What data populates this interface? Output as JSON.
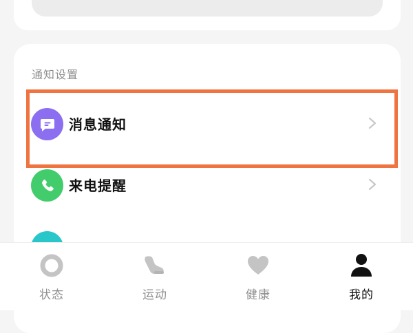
{
  "section": {
    "title": "通知设置"
  },
  "rows": [
    {
      "label": "消息通知",
      "icon": "message-icon",
      "color": "#8b6ff0"
    },
    {
      "label": "来电提醒",
      "icon": "phone-icon",
      "color": "#43cc6c"
    },
    {
      "label": "",
      "icon": "app-icon",
      "color": "#29c7c9"
    }
  ],
  "highlight_color": "#f07442",
  "tabbar": {
    "tabs": [
      {
        "label": "状态",
        "icon": "status-ring-icon",
        "active": false
      },
      {
        "label": "运动",
        "icon": "shoe-icon",
        "active": false
      },
      {
        "label": "健康",
        "icon": "heart-icon",
        "active": false
      },
      {
        "label": "我的",
        "icon": "person-icon",
        "active": true
      }
    ]
  }
}
